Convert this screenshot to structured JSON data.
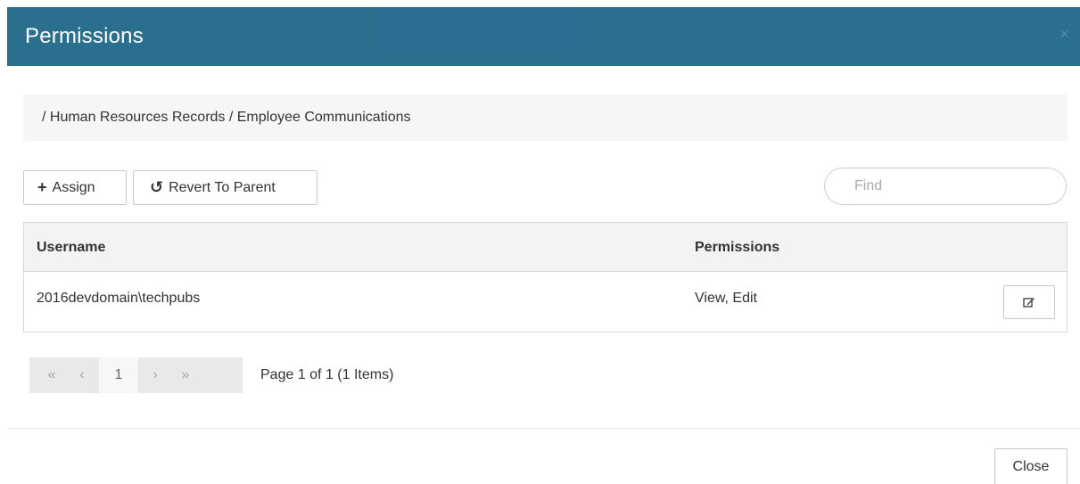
{
  "dialog": {
    "title": "Permissions",
    "close_icon": "×"
  },
  "breadcrumb": {
    "path": "/ Human Resources Records / Employee Communications"
  },
  "toolbar": {
    "assign_icon": "+",
    "assign_label": "Assign",
    "revert_icon": "↺",
    "revert_label": "Revert To Parent"
  },
  "search": {
    "placeholder": "Find",
    "value": ""
  },
  "grid": {
    "columns": [
      "Username",
      "Permissions"
    ],
    "rows": [
      {
        "username": "2016devdomain\\techpubs",
        "permissions": "View, Edit",
        "action_icon": "edit-icon"
      }
    ]
  },
  "pager": {
    "first": "«",
    "prev": "‹",
    "current": "1",
    "next": "›",
    "last": "»",
    "info": "Page 1 of 1 (1 Items)"
  },
  "footer": {
    "close_label": "Close"
  },
  "colors": {
    "header_bg": "#2a6f8e",
    "header_text": "#ffffff",
    "breadcrumb_bg": "#f6f6f6",
    "grid_header_bg": "#f3f3f3"
  }
}
